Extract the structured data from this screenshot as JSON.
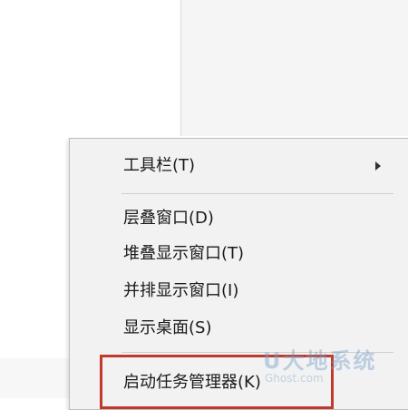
{
  "menu": {
    "items": [
      {
        "label": "工具栏(T)",
        "has_submenu": true
      },
      {
        "label": "层叠窗口(D)"
      },
      {
        "label": "堆叠显示窗口(T)"
      },
      {
        "label": "并排显示窗口(I)"
      },
      {
        "label": "显示桌面(S)"
      },
      {
        "label": "启动任务管理器(K)"
      }
    ]
  },
  "highlight": {
    "color": "#c0392b"
  },
  "watermark": {
    "text": "U大地系统",
    "subtext": "Ghost.com"
  }
}
